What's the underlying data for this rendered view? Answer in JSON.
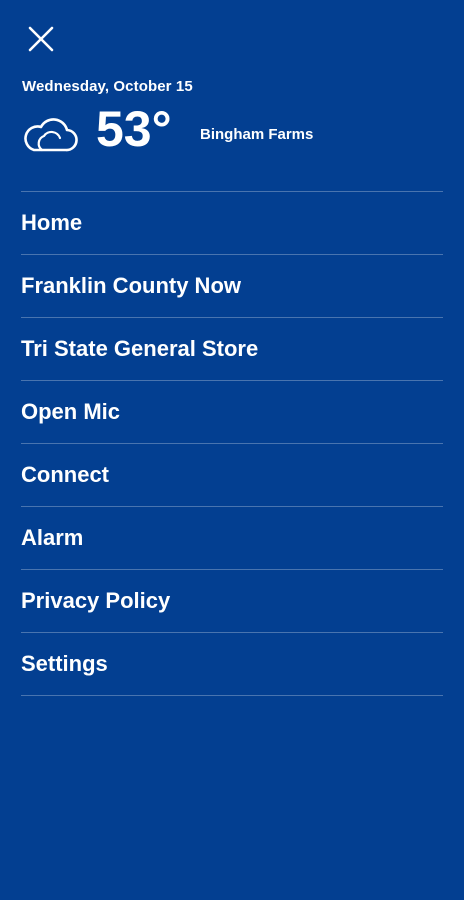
{
  "header": {
    "close_icon": "close-icon"
  },
  "weather": {
    "date": "Wednesday, October 15",
    "icon": "cloud-icon",
    "temperature": "53°",
    "location": "Bingham Farms"
  },
  "menu": {
    "items": [
      {
        "label": "Home"
      },
      {
        "label": "Franklin County Now"
      },
      {
        "label": "Tri State General Store"
      },
      {
        "label": "Open Mic"
      },
      {
        "label": "Connect"
      },
      {
        "label": "Alarm"
      },
      {
        "label": "Privacy Policy"
      },
      {
        "label": "Settings"
      }
    ]
  },
  "colors": {
    "background": "#033f91",
    "text": "#ffffff",
    "divider": "rgba(255,255,255,0.28)"
  }
}
